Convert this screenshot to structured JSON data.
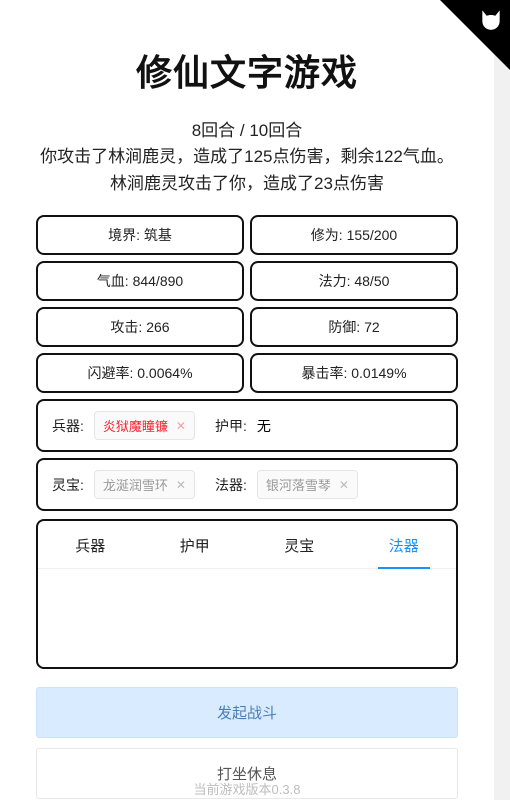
{
  "title": "修仙文字游戏",
  "battle": {
    "round": "8回合 / 10回合",
    "line1": "你攻击了林涧鹿灵，造成了125点伤害，剩余122气血。",
    "line2": "林涧鹿灵攻击了你，造成了23点伤害"
  },
  "stats": {
    "realm_label": "境界:",
    "realm_value": "筑基",
    "cultivation_label": "修为:",
    "cultivation_value": "155/200",
    "hp_label": "气血:",
    "hp_value": "844/890",
    "mp_label": "法力:",
    "mp_value": "48/50",
    "atk_label": "攻击:",
    "atk_value": "266",
    "def_label": "防御:",
    "def_value": "72",
    "dodge_label": "闪避率:",
    "dodge_value": "0.0064%",
    "crit_label": "暴击率:",
    "crit_value": "0.0149%"
  },
  "equip": {
    "weapon_label": "兵器:",
    "weapon_tag": "炎狱魔瞳镰",
    "armor_label": "护甲:",
    "armor_value": "无",
    "trinket_label": "灵宝:",
    "trinket_tag": "龙涎润雪环",
    "artifact_label": "法器:",
    "artifact_tag": "银河落雪琴"
  },
  "tabs": {
    "t1": "兵器",
    "t2": "护甲",
    "t3": "灵宝",
    "t4": "法器"
  },
  "actions": {
    "fight": "发起战斗",
    "rest": "打坐休息"
  },
  "version": "当前游戏版本0.3.8"
}
